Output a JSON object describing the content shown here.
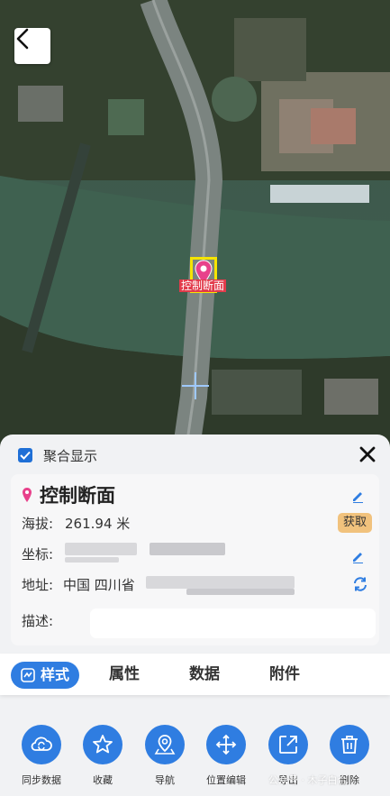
{
  "map": {
    "marker_label": "控制断面"
  },
  "sheet": {
    "cluster_label": "聚合显示",
    "title": "控制断面",
    "elevation": {
      "label": "海拔:",
      "value": "261.94 米",
      "fetch_label": "获取"
    },
    "coordinate": {
      "label": "坐标:"
    },
    "address": {
      "label": "地址:",
      "prefix": "中国 四川省"
    },
    "description": {
      "label": "描述:"
    }
  },
  "tabs": [
    "样式",
    "属性",
    "数据",
    "附件"
  ],
  "toolbar": [
    {
      "label": "同步数据",
      "icon": "cloud-sync-icon"
    },
    {
      "label": "收藏",
      "icon": "star-icon"
    },
    {
      "label": "导航",
      "icon": "map-pin-icon"
    },
    {
      "label": "位置编辑",
      "icon": "move-icon"
    },
    {
      "label": "导出",
      "icon": "export-icon"
    },
    {
      "label": "删除",
      "icon": "trash-icon"
    }
  ],
  "watermark": "公众号 · 木子白合",
  "colors": {
    "accent": "#2f7de1",
    "fetch": "#f1c27d",
    "marker": "#e8418b"
  }
}
